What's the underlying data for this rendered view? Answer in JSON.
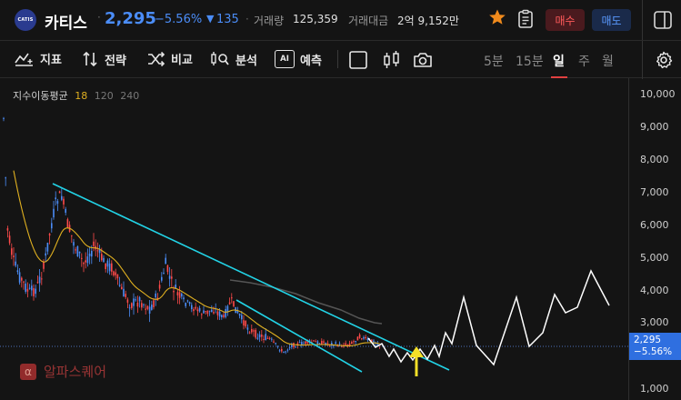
{
  "header": {
    "logo_text": "CATIS",
    "stock_name": "카티스",
    "separator": "·",
    "price": "2,295",
    "change_pct": "−5.56%",
    "change_arrow": "▼",
    "change_value": "135",
    "volume_label": "거래량",
    "volume_value": "125,359",
    "amount_label": "거래대금",
    "amount_value": "2억 9,152만",
    "buy_label": "매수",
    "sell_label": "매도"
  },
  "toolbar": {
    "indicator_label": "지표",
    "strategy_label": "전략",
    "compare_label": "비교",
    "analysis_label": "분석",
    "ai_badge": "AI",
    "forecast_label": "예측",
    "periods": [
      "5분",
      "15분",
      "일",
      "주",
      "월"
    ],
    "active_period": "일"
  },
  "legend": {
    "label": "지수이동평균",
    "p1": "18",
    "p2": "120",
    "p3": "240",
    "p1_color": "#e0b020",
    "p2_color": "#777777"
  },
  "y_axis": {
    "ticks": [
      "10,000",
      "9,000",
      "8,000",
      "7,000",
      "6,000",
      "5,000",
      "4,000",
      "3,000",
      "1,000"
    ]
  },
  "price_badge": {
    "price": "2,295",
    "pct": "−5.56%"
  },
  "watermark": {
    "icon": "α",
    "text": "알파스퀘어"
  },
  "colors": {
    "up": "#ff4a4a",
    "down": "#4b8df8",
    "trendline": "#22d3e6",
    "ema18": "#e0b020",
    "ema120": "#555555",
    "projection": "#ffffff",
    "arrow": "#f5e028",
    "accent": "#e04040"
  }
}
